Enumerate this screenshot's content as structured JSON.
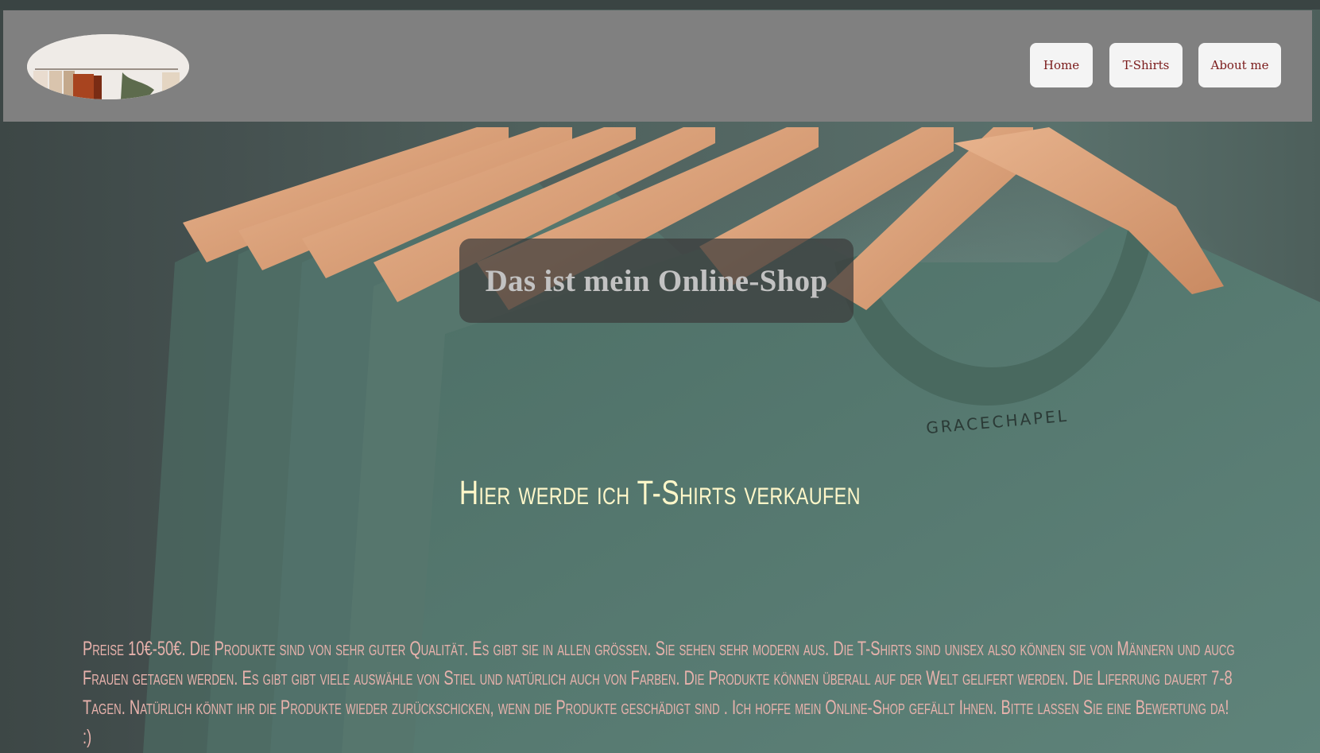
{
  "header": {
    "logo_alt": "logo",
    "nav": {
      "home": "Home",
      "tshirts": "T-Shirts",
      "about": "About me"
    }
  },
  "hero": {
    "title": "Das ist mein Online-Shop",
    "subtitle": "Hier werde ich T-Shirts verkaufen",
    "description": "Preise 10€-50€. Die Produkte sind von sehr guter Qualität. Es gibt sie in allen größen. Sie sehen sehr modern aus. Die T-Shirts sind unisex also können sie von Männern und aucg Frauen getagen werden. Es gibt gibt viele auswähle von Stiel und natürlich auch von Farben. Die Produkte können überall auf der Welt gelifert werden. Die Liferrung dauert 7-8 Tagen.  Natürlich könnt ihr die Produkte wieder zurückschicken, wenn die Produkte geschädigt sind . Ich hoffe mein Online-Shop gefällt Ihnen. Bitte lassen Sie eine Bewertung da! :)"
  },
  "colors": {
    "header_bg": "#808080",
    "nav_bg": "#f4f4f4",
    "nav_text": "#7a1a1a",
    "title_box_bg": "#3c3c3c",
    "title_text": "#c2c2c2",
    "subtitle_text": "#fff7c9",
    "description_text": "#e8b2ac"
  },
  "icons": {
    "background": "t-shirts-on-hangers-photo",
    "logo": "clothing-rack-photo"
  }
}
